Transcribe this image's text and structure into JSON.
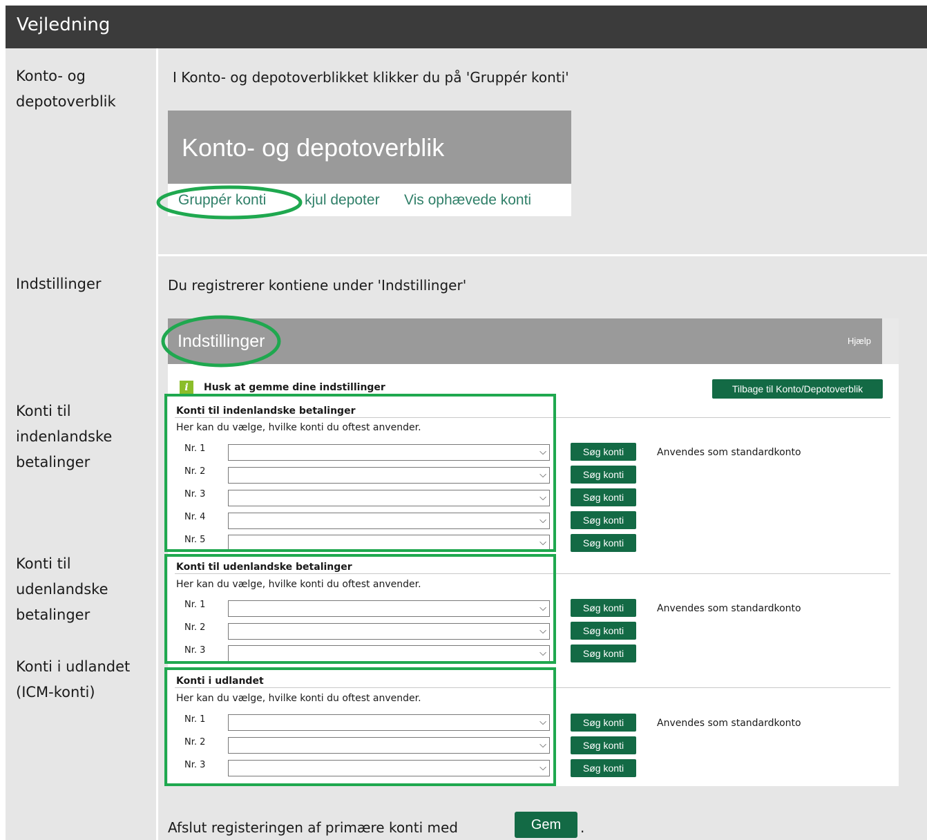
{
  "title": "Vejledning",
  "section1": {
    "label": "Konto- og depotoverblik",
    "instruction": "I Konto- og depotoverblikket klikker du på 'Gruppér konti'",
    "screenshot_title": "Konto- og depotoverblik",
    "links": [
      "Gruppér konti",
      "Skjul depoter",
      "Vis ophævede konti"
    ],
    "links_visible": [
      "Gruppér konti",
      "kjul depoter",
      "Vis ophævede konti"
    ]
  },
  "section2": {
    "label": "Indstillinger",
    "instruction": "Du registrerer kontiene under 'Indstillinger'",
    "screenshot_title": "Indstillinger",
    "help": "Hjælp",
    "info": "Husk at gemme dine indstillinger",
    "back_button": "Tilbage til Konto/Depotoverblik",
    "groups": [
      {
        "side_label": "Konti til indenlandske betalinger",
        "title": "Konti til indenlandske betalinger",
        "desc": "Her kan du vælge, hvilke konti du oftest anvender.",
        "rows": [
          "Nr. 1",
          "Nr. 2",
          "Nr. 3",
          "Nr. 4",
          "Nr. 5"
        ]
      },
      {
        "side_label": "Konti til udenlandske betalinger",
        "title": "Konti til udenlandske betalinger",
        "desc": "Her kan du vælge, hvilke konti du oftest anvender.",
        "rows": [
          "Nr. 1",
          "Nr. 2",
          "Nr. 3"
        ]
      },
      {
        "side_label": "Konti i udlandet (ICM-konti)",
        "title": "Konti i udlandet",
        "desc": "Her kan du vælge, hvilke konti du oftest anvender.",
        "rows": [
          "Nr. 1",
          "Nr. 2",
          "Nr. 3"
        ]
      }
    ],
    "search_button": "Søg konti",
    "standard_note": "Anvendes som standardkonto",
    "chevron": "chevron-down-icon",
    "info_icon": "info-icon"
  },
  "footer": {
    "text": "Afslut registeringen af primære konti med",
    "save_button": "Gem",
    "period": "."
  },
  "colors": {
    "title_bar": "#3b3b3b",
    "panel": "#e6e6e6",
    "highlight": "#1fa84f",
    "button": "#136a45",
    "link": "#2f7f68"
  }
}
